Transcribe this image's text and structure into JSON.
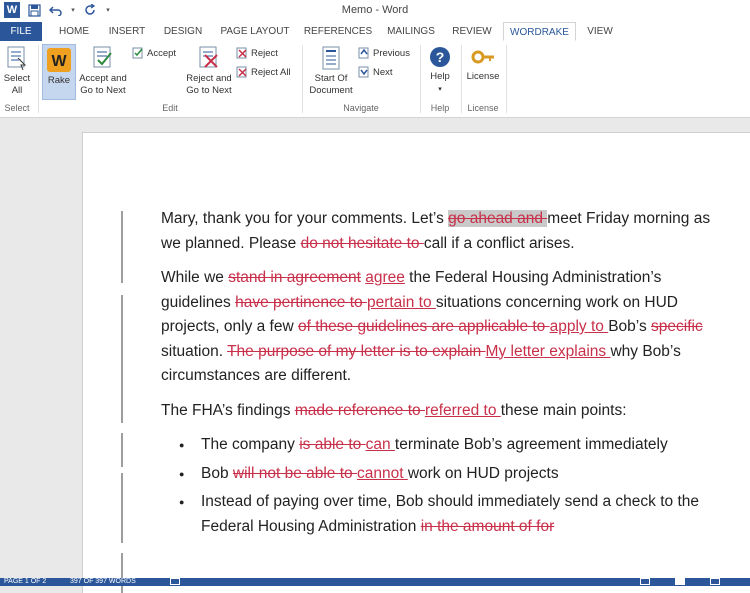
{
  "window": {
    "title": "Memo - Word"
  },
  "tabs": [
    {
      "label": "FILE"
    },
    {
      "label": "HOME"
    },
    {
      "label": "INSERT"
    },
    {
      "label": "DESIGN"
    },
    {
      "label": "PAGE LAYOUT"
    },
    {
      "label": "REFERENCES"
    },
    {
      "label": "MAILINGS"
    },
    {
      "label": "REVIEW"
    },
    {
      "label": "WORDRAKE"
    },
    {
      "label": "VIEW"
    }
  ],
  "ribbon": {
    "select": {
      "line1": "Select",
      "line2": "All",
      "group": "Select"
    },
    "rake": {
      "label": "Rake"
    },
    "accept_next": {
      "line1": "Accept and",
      "line2": "Go to Next"
    },
    "accept": {
      "label": "Accept"
    },
    "reject_next": {
      "line1": "Reject and",
      "line2": "Go to Next"
    },
    "reject": {
      "label": "Reject"
    },
    "reject_all": {
      "label": "Reject All"
    },
    "edit_group": "Edit",
    "start_doc": {
      "line1": "Start Of",
      "line2": "Document"
    },
    "previous": {
      "label": "Previous"
    },
    "next": {
      "label": "Next"
    },
    "navigate_group": "Navigate",
    "help": {
      "label": "Help",
      "group": "Help"
    },
    "license": {
      "label": "License",
      "group": "License"
    }
  },
  "document": {
    "p1": {
      "t1": "Mary, thank you for your comments.  Let’s ",
      "d1": "go ahead and ",
      "t2": "meet Friday morning as we planned.  Please ",
      "d2": "do not hesitate to ",
      "t3": "call if a conflict arises."
    },
    "p2": {
      "t1": "While we ",
      "d1": "stand in ",
      "d2": "agreement",
      "s1": " ",
      "i1": "agree",
      "t2": " the Federal Housing Administration’s guidelines ",
      "d3": "have pertinence to ",
      "i2": "pertain to ",
      "t3": "situations concerning work on HUD projects, only a few ",
      "d4": "of these guidelines are applicable to ",
      "i3": "apply to ",
      "t4": "Bob’s ",
      "d5": "specific ",
      "t5": "situation.  ",
      "d6": "The purpose of my letter is to explain ",
      "i4": "My letter explains ",
      "t6": "why Bob’s circumstances are different."
    },
    "p3": {
      "t1": "The FHA’s findings ",
      "d1": "made reference to ",
      "i1": "referred to ",
      "t2": "these main points:"
    },
    "bullets": {
      "b1": {
        "t1": "The company ",
        "d1": "is able to ",
        "i1": "can ",
        "t2": "terminate Bob’s agreement immediately"
      },
      "b2": {
        "t1": "Bob ",
        "d1": "will not be able to ",
        "i1": "cannot ",
        "t2": "work on HUD projects"
      },
      "b3": {
        "t1": "Instead of paying over time, Bob should immediately send a check to the Federal Housing Administration ",
        "d1": "in the amount of for"
      }
    }
  },
  "status": {
    "page": "PAGE 1 OF 2",
    "words": "397 OF 397 WORDS"
  },
  "colors": {
    "accent": "#2b579a",
    "revision": "#c8304a"
  }
}
